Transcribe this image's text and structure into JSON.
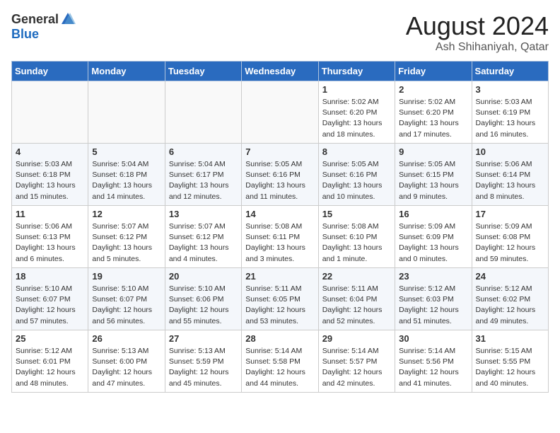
{
  "header": {
    "logo_general": "General",
    "logo_blue": "Blue",
    "month_title": "August 2024",
    "location": "Ash Shihaniyah, Qatar"
  },
  "weekdays": [
    "Sunday",
    "Monday",
    "Tuesday",
    "Wednesday",
    "Thursday",
    "Friday",
    "Saturday"
  ],
  "weeks": [
    [
      {
        "day": "",
        "info": ""
      },
      {
        "day": "",
        "info": ""
      },
      {
        "day": "",
        "info": ""
      },
      {
        "day": "",
        "info": ""
      },
      {
        "day": "1",
        "info": "Sunrise: 5:02 AM\nSunset: 6:20 PM\nDaylight: 13 hours\nand 18 minutes."
      },
      {
        "day": "2",
        "info": "Sunrise: 5:02 AM\nSunset: 6:20 PM\nDaylight: 13 hours\nand 17 minutes."
      },
      {
        "day": "3",
        "info": "Sunrise: 5:03 AM\nSunset: 6:19 PM\nDaylight: 13 hours\nand 16 minutes."
      }
    ],
    [
      {
        "day": "4",
        "info": "Sunrise: 5:03 AM\nSunset: 6:18 PM\nDaylight: 13 hours\nand 15 minutes."
      },
      {
        "day": "5",
        "info": "Sunrise: 5:04 AM\nSunset: 6:18 PM\nDaylight: 13 hours\nand 14 minutes."
      },
      {
        "day": "6",
        "info": "Sunrise: 5:04 AM\nSunset: 6:17 PM\nDaylight: 13 hours\nand 12 minutes."
      },
      {
        "day": "7",
        "info": "Sunrise: 5:05 AM\nSunset: 6:16 PM\nDaylight: 13 hours\nand 11 minutes."
      },
      {
        "day": "8",
        "info": "Sunrise: 5:05 AM\nSunset: 6:16 PM\nDaylight: 13 hours\nand 10 minutes."
      },
      {
        "day": "9",
        "info": "Sunrise: 5:05 AM\nSunset: 6:15 PM\nDaylight: 13 hours\nand 9 minutes."
      },
      {
        "day": "10",
        "info": "Sunrise: 5:06 AM\nSunset: 6:14 PM\nDaylight: 13 hours\nand 8 minutes."
      }
    ],
    [
      {
        "day": "11",
        "info": "Sunrise: 5:06 AM\nSunset: 6:13 PM\nDaylight: 13 hours\nand 6 minutes."
      },
      {
        "day": "12",
        "info": "Sunrise: 5:07 AM\nSunset: 6:12 PM\nDaylight: 13 hours\nand 5 minutes."
      },
      {
        "day": "13",
        "info": "Sunrise: 5:07 AM\nSunset: 6:12 PM\nDaylight: 13 hours\nand 4 minutes."
      },
      {
        "day": "14",
        "info": "Sunrise: 5:08 AM\nSunset: 6:11 PM\nDaylight: 13 hours\nand 3 minutes."
      },
      {
        "day": "15",
        "info": "Sunrise: 5:08 AM\nSunset: 6:10 PM\nDaylight: 13 hours\nand 1 minute."
      },
      {
        "day": "16",
        "info": "Sunrise: 5:09 AM\nSunset: 6:09 PM\nDaylight: 13 hours\nand 0 minutes."
      },
      {
        "day": "17",
        "info": "Sunrise: 5:09 AM\nSunset: 6:08 PM\nDaylight: 12 hours\nand 59 minutes."
      }
    ],
    [
      {
        "day": "18",
        "info": "Sunrise: 5:10 AM\nSunset: 6:07 PM\nDaylight: 12 hours\nand 57 minutes."
      },
      {
        "day": "19",
        "info": "Sunrise: 5:10 AM\nSunset: 6:07 PM\nDaylight: 12 hours\nand 56 minutes."
      },
      {
        "day": "20",
        "info": "Sunrise: 5:10 AM\nSunset: 6:06 PM\nDaylight: 12 hours\nand 55 minutes."
      },
      {
        "day": "21",
        "info": "Sunrise: 5:11 AM\nSunset: 6:05 PM\nDaylight: 12 hours\nand 53 minutes."
      },
      {
        "day": "22",
        "info": "Sunrise: 5:11 AM\nSunset: 6:04 PM\nDaylight: 12 hours\nand 52 minutes."
      },
      {
        "day": "23",
        "info": "Sunrise: 5:12 AM\nSunset: 6:03 PM\nDaylight: 12 hours\nand 51 minutes."
      },
      {
        "day": "24",
        "info": "Sunrise: 5:12 AM\nSunset: 6:02 PM\nDaylight: 12 hours\nand 49 minutes."
      }
    ],
    [
      {
        "day": "25",
        "info": "Sunrise: 5:12 AM\nSunset: 6:01 PM\nDaylight: 12 hours\nand 48 minutes."
      },
      {
        "day": "26",
        "info": "Sunrise: 5:13 AM\nSunset: 6:00 PM\nDaylight: 12 hours\nand 47 minutes."
      },
      {
        "day": "27",
        "info": "Sunrise: 5:13 AM\nSunset: 5:59 PM\nDaylight: 12 hours\nand 45 minutes."
      },
      {
        "day": "28",
        "info": "Sunrise: 5:14 AM\nSunset: 5:58 PM\nDaylight: 12 hours\nand 44 minutes."
      },
      {
        "day": "29",
        "info": "Sunrise: 5:14 AM\nSunset: 5:57 PM\nDaylight: 12 hours\nand 42 minutes."
      },
      {
        "day": "30",
        "info": "Sunrise: 5:14 AM\nSunset: 5:56 PM\nDaylight: 12 hours\nand 41 minutes."
      },
      {
        "day": "31",
        "info": "Sunrise: 5:15 AM\nSunset: 5:55 PM\nDaylight: 12 hours\nand 40 minutes."
      }
    ]
  ]
}
